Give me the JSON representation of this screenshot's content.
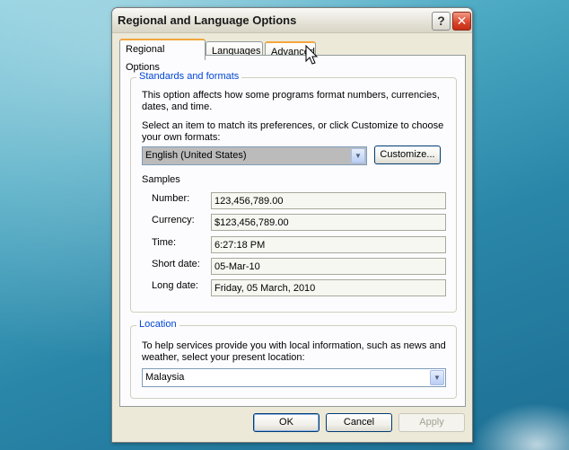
{
  "dialog": {
    "title": "Regional and Language Options",
    "help_label": "?",
    "close_label": "✕"
  },
  "tabs": [
    {
      "label": "Regional Options"
    },
    {
      "label": "Languages"
    },
    {
      "label": "Advanced"
    }
  ],
  "standards": {
    "legend": "Standards and formats",
    "description": "This option affects how some programs format numbers, currencies, dates, and time.",
    "instruction": "Select an item to match its preferences, or click Customize to choose your own formats:",
    "selected_format": "English (United States)",
    "customize_label": "Customize...",
    "samples_heading": "Samples",
    "samples": [
      {
        "label": "Number:",
        "value": "123,456,789.00"
      },
      {
        "label": "Currency:",
        "value": "$123,456,789.00"
      },
      {
        "label": "Time:",
        "value": "6:27:18 PM"
      },
      {
        "label": "Short date:",
        "value": "05-Mar-10"
      },
      {
        "label": "Long date:",
        "value": "Friday, 05 March, 2010"
      }
    ]
  },
  "location": {
    "legend": "Location",
    "description": "To help services provide you with local information, such as news and weather, select your present location:",
    "selected": "Malaysia"
  },
  "footer": {
    "ok_label": "OK",
    "cancel_label": "Cancel",
    "apply_label": "Apply"
  }
}
